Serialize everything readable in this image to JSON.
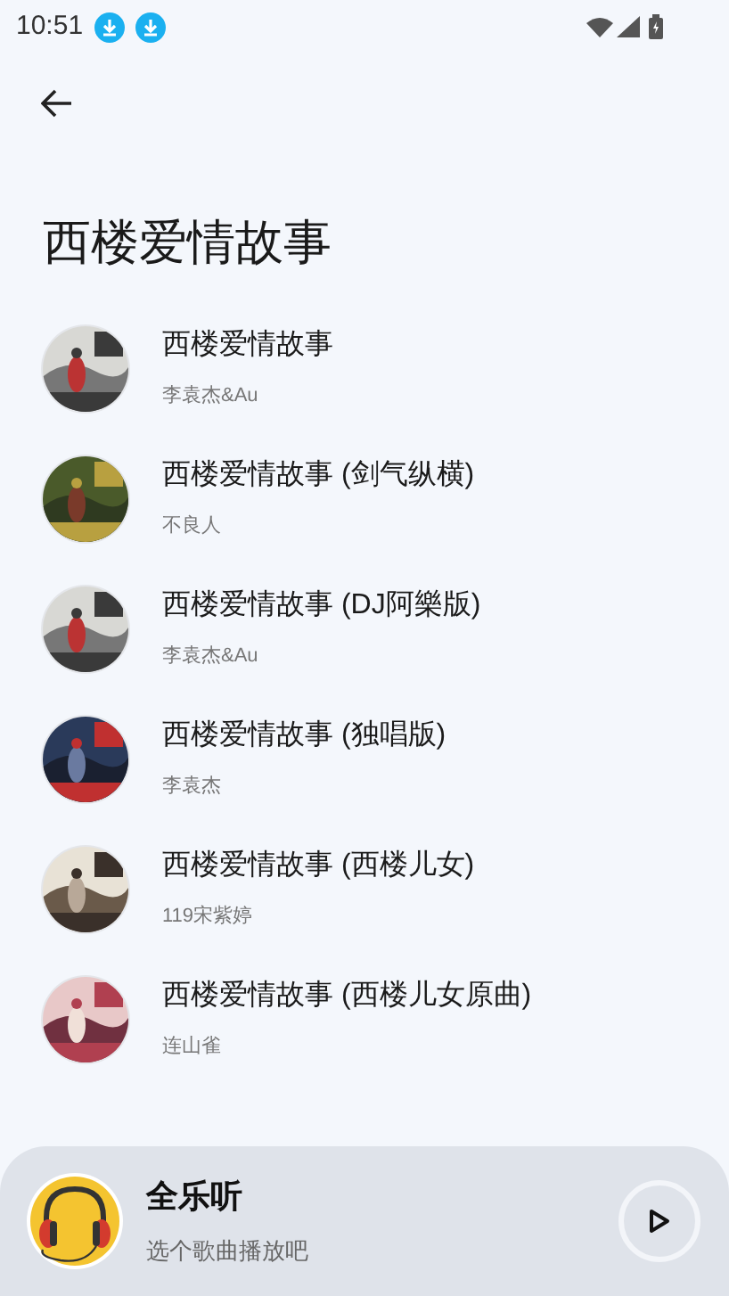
{
  "status_bar": {
    "time": "10:51",
    "notifications": [
      {
        "kind": "download"
      },
      {
        "kind": "download"
      }
    ]
  },
  "title": "西楼爱情故事",
  "songs": [
    {
      "title": "西楼爱情故事",
      "artist": "李袁杰&Au"
    },
    {
      "title": "西楼爱情故事 (剑气纵横)",
      "artist": "不良人"
    },
    {
      "title": "西楼爱情故事 (DJ阿樂版)",
      "artist": "李袁杰&Au"
    },
    {
      "title": "西楼爱情故事 (独唱版)",
      "artist": "李袁杰"
    },
    {
      "title": "西楼爱情故事 (西楼儿女)",
      "artist": "119宋紫婷"
    },
    {
      "title": "西楼爱情故事 (西楼儿女原曲)",
      "artist": "连山雀"
    }
  ],
  "player": {
    "title": "全乐听",
    "subtitle": "选个歌曲播放吧"
  }
}
